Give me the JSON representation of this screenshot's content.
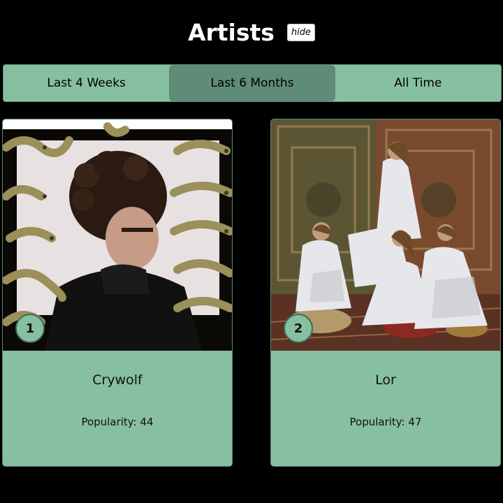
{
  "header": {
    "title": "Artists",
    "hide_label": "hide"
  },
  "tabs": [
    {
      "label": "Last 4 Weeks",
      "active": false
    },
    {
      "label": "Last 6 Months",
      "active": true
    },
    {
      "label": "All Time",
      "active": false
    }
  ],
  "artists": [
    {
      "rank": "1",
      "name": "Crywolf",
      "popularity": "Popularity: 44"
    },
    {
      "rank": "2",
      "name": "Lor",
      "popularity": "Popularity: 47"
    }
  ],
  "colors": {
    "background": "#000000",
    "accent": "#87bfa2",
    "active_tab": "#5f8c76"
  }
}
